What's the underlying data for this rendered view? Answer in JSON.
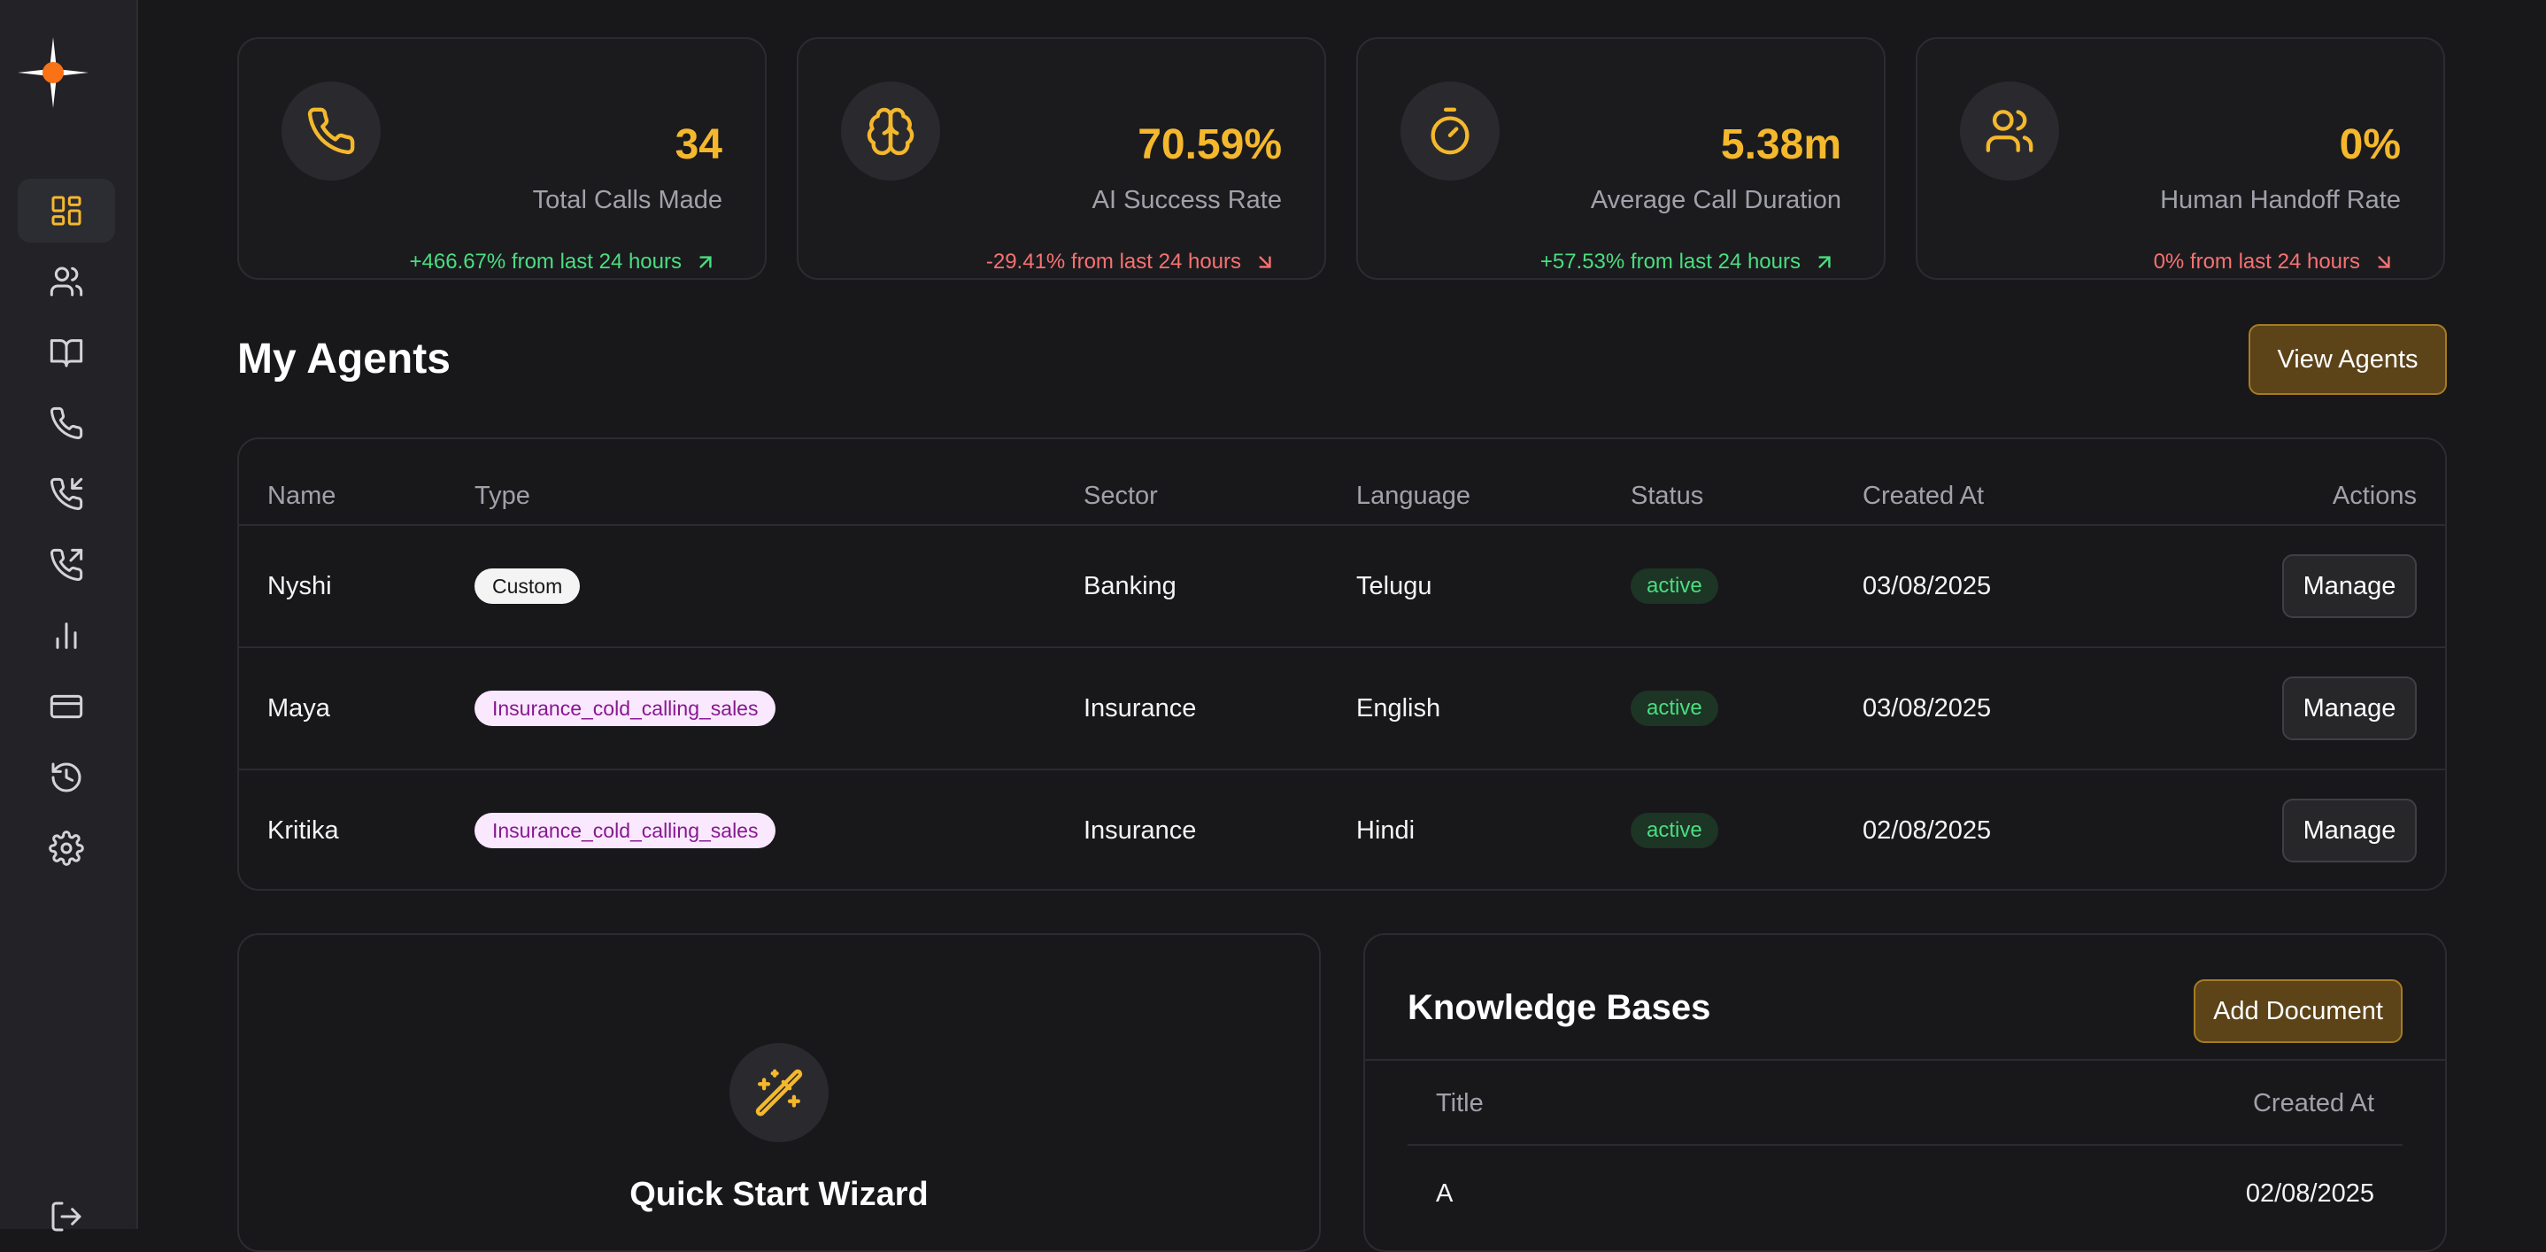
{
  "sidebar": {
    "logo": "plus-star-logo",
    "items": [
      {
        "icon": "dashboard-icon",
        "active": true
      },
      {
        "icon": "users-icon"
      },
      {
        "icon": "book-icon"
      },
      {
        "icon": "phone-icon"
      },
      {
        "icon": "phone-incoming-icon"
      },
      {
        "icon": "phone-outgoing-icon"
      },
      {
        "icon": "bar-chart-icon"
      },
      {
        "icon": "credit-card-icon"
      },
      {
        "icon": "history-icon"
      },
      {
        "icon": "settings-icon"
      }
    ],
    "logout_icon": "logout-icon"
  },
  "stats": [
    {
      "icon": "phone-icon",
      "value": "34",
      "label": "Total Calls Made",
      "change": "+466.67% from last 24 hours",
      "trend": "up"
    },
    {
      "icon": "brain-icon",
      "value": "70.59%",
      "label": "AI Success Rate",
      "change": "-29.41% from last 24 hours",
      "trend": "down"
    },
    {
      "icon": "timer-icon",
      "value": "5.38m",
      "label": "Average Call Duration",
      "change": "+57.53% from last 24 hours",
      "trend": "up"
    },
    {
      "icon": "users-icon",
      "value": "0%",
      "label": "Human Handoff Rate",
      "change": "0% from last 24 hours",
      "trend": "down"
    }
  ],
  "agents": {
    "title": "My Agents",
    "view_button": "View Agents",
    "columns": [
      "Name",
      "Type",
      "Sector",
      "Language",
      "Status",
      "Created At",
      "Actions"
    ],
    "rows": [
      {
        "name": "Nyshi",
        "type": "Custom",
        "sector": "Banking",
        "language": "Telugu",
        "status": "active",
        "created": "03/08/2025",
        "action": "Manage"
      },
      {
        "name": "Maya",
        "type": "Insurance_cold_calling_sales",
        "sector": "Insurance",
        "language": "English",
        "status": "active",
        "created": "03/08/2025",
        "action": "Manage"
      },
      {
        "name": "Kritika",
        "type": "Insurance_cold_calling_sales",
        "sector": "Insurance",
        "language": "Hindi",
        "status": "active",
        "created": "02/08/2025",
        "action": "Manage"
      }
    ]
  },
  "wizard": {
    "icon": "magic-wand-icon",
    "title": "Quick Start Wizard"
  },
  "knowledge": {
    "title": "Knowledge Bases",
    "add_button": "Add Document",
    "columns": [
      "Title",
      "Created At"
    ],
    "rows": [
      {
        "title": "A",
        "created": "02/08/2025"
      }
    ]
  },
  "colors": {
    "accent": "#f5b82c",
    "brand_logo": "#f97316",
    "positive": "#4ade80",
    "negative": "#f87171",
    "background": "#18181b"
  }
}
